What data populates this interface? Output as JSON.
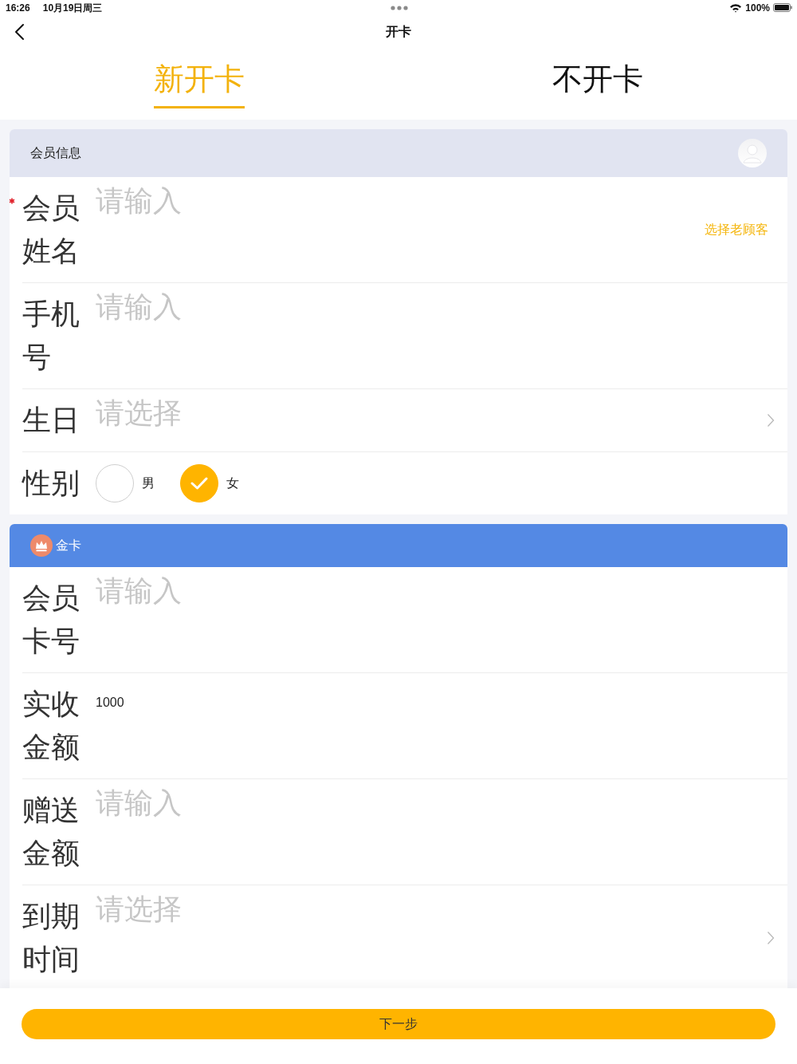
{
  "status_bar": {
    "time": "16:26",
    "date": "10月19日周三",
    "battery": "100%"
  },
  "nav_bar": {
    "title": "开卡"
  },
  "tabs": [
    {
      "label": "新开卡",
      "selected": true
    },
    {
      "label": "不开卡",
      "selected": false
    }
  ],
  "sections": [
    {
      "kind": "member",
      "title": "会员信息",
      "fields": [
        {
          "kind": "input",
          "label": "会员姓名",
          "required": true,
          "placeholder": "请输入",
          "action": "选择老顾客"
        },
        {
          "kind": "input",
          "label": "手机号",
          "required": false,
          "placeholder": "请输入"
        },
        {
          "kind": "picker",
          "label": "生日",
          "required": false,
          "placeholder": "请选择"
        },
        {
          "kind": "radio",
          "label": "性别",
          "required": false,
          "options": [
            {
              "label": "男",
              "selected": false
            },
            {
              "label": "女",
              "selected": true
            }
          ]
        }
      ]
    },
    {
      "kind": "card",
      "title": "金卡",
      "fields": [
        {
          "kind": "input",
          "label": "会员卡号",
          "required": false,
          "placeholder": "请输入"
        },
        {
          "kind": "input",
          "label": "实收金额",
          "required": false,
          "value": "1000"
        },
        {
          "kind": "input",
          "label": "赠送金额",
          "required": false,
          "placeholder": "请输入"
        },
        {
          "kind": "picker",
          "label": "到期时间",
          "required": false,
          "placeholder": "请选择"
        }
      ]
    }
  ],
  "next_button": "下一步"
}
